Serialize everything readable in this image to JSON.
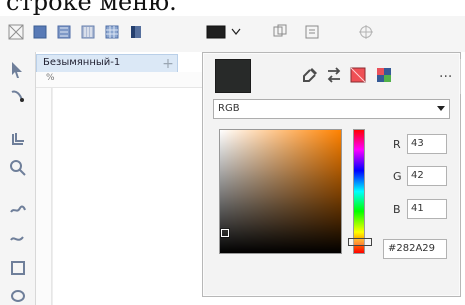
{
  "top_crop_text": "строке меню.",
  "document": {
    "tab_title": "Безымянный-1",
    "ruler_label": "%"
  },
  "color_panel": {
    "current_hex_color": "#282A29",
    "color_model": "RGB",
    "channels": {
      "r_label": "R",
      "r_value": "43",
      "g_label": "G",
      "g_value": "42",
      "b_label": "B",
      "b_value": "41"
    },
    "hex_value": "#282A29",
    "more_label": "..."
  },
  "icons": {
    "toolbar": [
      "grid-icon",
      "fill-icon",
      "pattern-icon",
      "distribute-icon",
      "table-icon",
      "panel-icon",
      "color-icon",
      "chevron-down-icon",
      "copy-icon",
      "frame-icon",
      "target-icon"
    ],
    "toolbox": [
      "pointer-icon",
      "shape-icon",
      "crop-icon",
      "zoom-icon",
      "freehand-icon",
      "curve-icon",
      "rectangle-icon",
      "ellipse-icon"
    ],
    "color_panel": [
      "eyedropper-icon",
      "swap-icon",
      "palette-icon",
      "mixer-icon",
      "more-icon"
    ]
  },
  "colors": {
    "accent_orange": "#ff8200",
    "selection_blue": "#dbe8f6",
    "panel_bg": "#f3f3f3"
  }
}
